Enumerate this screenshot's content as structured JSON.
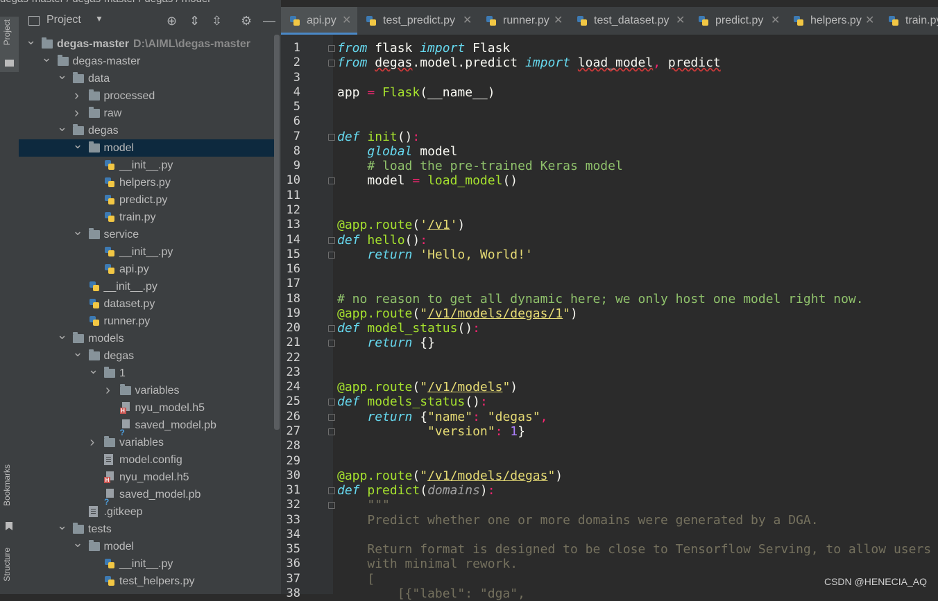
{
  "breadcrumb": {
    "items": [
      "degas-master",
      "degas-master",
      "degas",
      "model"
    ],
    "sep": " / "
  },
  "left_strip": {
    "project_label": "Project",
    "bookmarks_label": "Bookmarks",
    "structure_label": "Structure"
  },
  "project_panel": {
    "title": "Project"
  },
  "tree": [
    {
      "label": "degas-master",
      "sub": "D:\\AIML\\degas-master",
      "depth": 0,
      "arrow": "down",
      "icon": "folder",
      "bold": true
    },
    {
      "label": "degas-master",
      "depth": 1,
      "arrow": "down",
      "icon": "folder"
    },
    {
      "label": "data",
      "depth": 2,
      "arrow": "down",
      "icon": "folder"
    },
    {
      "label": "processed",
      "depth": 3,
      "arrow": "right",
      "icon": "folder"
    },
    {
      "label": "raw",
      "depth": 3,
      "arrow": "right",
      "icon": "folder"
    },
    {
      "label": "degas",
      "depth": 2,
      "arrow": "down",
      "icon": "folder"
    },
    {
      "label": "model",
      "depth": 3,
      "arrow": "down",
      "icon": "folder",
      "selected": true
    },
    {
      "label": "__init__.py",
      "depth": 4,
      "icon": "py"
    },
    {
      "label": "helpers.py",
      "depth": 4,
      "icon": "py"
    },
    {
      "label": "predict.py",
      "depth": 4,
      "icon": "py"
    },
    {
      "label": "train.py",
      "depth": 4,
      "icon": "py"
    },
    {
      "label": "service",
      "depth": 3,
      "arrow": "down",
      "icon": "folder"
    },
    {
      "label": "__init__.py",
      "depth": 4,
      "icon": "py"
    },
    {
      "label": "api.py",
      "depth": 4,
      "icon": "py"
    },
    {
      "label": "__init__.py",
      "depth": 3,
      "icon": "py"
    },
    {
      "label": "dataset.py",
      "depth": 3,
      "icon": "py"
    },
    {
      "label": "runner.py",
      "depth": 3,
      "icon": "py"
    },
    {
      "label": "models",
      "depth": 2,
      "arrow": "down",
      "icon": "folder"
    },
    {
      "label": "degas",
      "depth": 3,
      "arrow": "down",
      "icon": "folder"
    },
    {
      "label": "1",
      "depth": 4,
      "arrow": "down",
      "icon": "folder"
    },
    {
      "label": "variables",
      "depth": 5,
      "arrow": "right",
      "icon": "folder"
    },
    {
      "label": "nyu_model.h5",
      "depth": 5,
      "icon": "h5"
    },
    {
      "label": "saved_model.pb",
      "depth": 5,
      "icon": "pb"
    },
    {
      "label": "variables",
      "depth": 4,
      "arrow": "right",
      "icon": "folder"
    },
    {
      "label": "model.config",
      "depth": 4,
      "icon": "txt"
    },
    {
      "label": "nyu_model.h5",
      "depth": 4,
      "icon": "h5"
    },
    {
      "label": "saved_model.pb",
      "depth": 4,
      "icon": "pb"
    },
    {
      "label": ".gitkeep",
      "depth": 3,
      "icon": "txt"
    },
    {
      "label": "tests",
      "depth": 2,
      "arrow": "down",
      "icon": "folder"
    },
    {
      "label": "model",
      "depth": 3,
      "arrow": "down",
      "icon": "folder"
    },
    {
      "label": "__init__.py",
      "depth": 4,
      "icon": "py"
    },
    {
      "label": "test_helpers.py",
      "depth": 4,
      "icon": "py"
    }
  ],
  "tabs": [
    {
      "label": "api.py",
      "active": true
    },
    {
      "label": "test_predict.py"
    },
    {
      "label": "runner.py"
    },
    {
      "label": "test_dataset.py"
    },
    {
      "label": "predict.py"
    },
    {
      "label": "helpers.py"
    },
    {
      "label": "train.py"
    }
  ],
  "editor": {
    "highlight_line": 33,
    "lines": [
      [
        [
          "kw",
          "from"
        ],
        [
          "pl",
          " flask "
        ],
        [
          "kw",
          "import"
        ],
        [
          "pl",
          " Flask"
        ]
      ],
      [
        [
          "kw",
          "from"
        ],
        [
          "pl",
          " "
        ],
        [
          "wavy",
          "degas"
        ],
        [
          "pl",
          ".model.predict "
        ],
        [
          "kw",
          "import"
        ],
        [
          "pl",
          " "
        ],
        [
          "wavy",
          "load_model"
        ],
        [
          "op",
          ", "
        ],
        [
          "wavy",
          "predict"
        ]
      ],
      [],
      [
        [
          "pl",
          "app "
        ],
        [
          "op",
          "="
        ],
        [
          "pl",
          " "
        ],
        [
          "fn",
          "Flask"
        ],
        [
          "pl",
          "(__name__)"
        ]
      ],
      [],
      [],
      [
        [
          "kw",
          "def"
        ],
        [
          "pl",
          " "
        ],
        [
          "fn",
          "init"
        ],
        [
          "pl",
          "()"
        ],
        [
          "op",
          ":"
        ]
      ],
      [
        [
          "pl",
          "    "
        ],
        [
          "kw",
          "global"
        ],
        [
          "pl",
          " model"
        ]
      ],
      [
        [
          "pl",
          "    "
        ],
        [
          "cm",
          "# load the pre-trained Keras model"
        ]
      ],
      [
        [
          "pl",
          "    model "
        ],
        [
          "op",
          "="
        ],
        [
          "pl",
          " "
        ],
        [
          "fn",
          "load_model"
        ],
        [
          "pl",
          "()"
        ]
      ],
      [],
      [],
      [
        [
          "dec",
          "@app.route"
        ],
        [
          "pl",
          "("
        ],
        [
          "str",
          "'"
        ],
        [
          "stru",
          "/v1"
        ],
        [
          "str",
          "'"
        ],
        [
          "pl",
          ")"
        ]
      ],
      [
        [
          "kw",
          "def"
        ],
        [
          "pl",
          " "
        ],
        [
          "fn",
          "hello"
        ],
        [
          "pl",
          "()"
        ],
        [
          "op",
          ":"
        ]
      ],
      [
        [
          "pl",
          "    "
        ],
        [
          "kw",
          "return"
        ],
        [
          "pl",
          " "
        ],
        [
          "str",
          "'Hello, World!'"
        ]
      ],
      [],
      [],
      [
        [
          "cm",
          "# no reason to get all dynamic here; we only host one model right now."
        ]
      ],
      [
        [
          "dec",
          "@app.route"
        ],
        [
          "pl",
          "("
        ],
        [
          "str",
          "\""
        ],
        [
          "stru",
          "/v1/models/degas/1"
        ],
        [
          "str",
          "\""
        ],
        [
          "pl",
          ")"
        ]
      ],
      [
        [
          "kw",
          "def"
        ],
        [
          "pl",
          " "
        ],
        [
          "fn",
          "model_status"
        ],
        [
          "pl",
          "()"
        ],
        [
          "op",
          ":"
        ]
      ],
      [
        [
          "pl",
          "    "
        ],
        [
          "kw",
          "return"
        ],
        [
          "pl",
          " {}"
        ]
      ],
      [],
      [],
      [
        [
          "dec",
          "@app.route"
        ],
        [
          "pl",
          "("
        ],
        [
          "str",
          "\""
        ],
        [
          "stru",
          "/v1/models"
        ],
        [
          "str",
          "\""
        ],
        [
          "pl",
          ")"
        ]
      ],
      [
        [
          "kw",
          "def"
        ],
        [
          "pl",
          " "
        ],
        [
          "fn",
          "models_status"
        ],
        [
          "pl",
          "()"
        ],
        [
          "op",
          ":"
        ]
      ],
      [
        [
          "pl",
          "    "
        ],
        [
          "kw",
          "return"
        ],
        [
          "pl",
          " {"
        ],
        [
          "str",
          "\"name\""
        ],
        [
          "op",
          ":"
        ],
        [
          "pl",
          " "
        ],
        [
          "str",
          "\"degas\""
        ],
        [
          "op",
          ","
        ]
      ],
      [
        [
          "pl",
          "            "
        ],
        [
          "str",
          "\"version\""
        ],
        [
          "op",
          ":"
        ],
        [
          "pl",
          " "
        ],
        [
          "num",
          "1"
        ],
        [
          "pl",
          "}"
        ]
      ],
      [],
      [],
      [
        [
          "dec",
          "@app.route"
        ],
        [
          "pl",
          "("
        ],
        [
          "str",
          "\""
        ],
        [
          "stru",
          "/v1/models/degas"
        ],
        [
          "str",
          "\""
        ],
        [
          "pl",
          ")"
        ]
      ],
      [
        [
          "kw",
          "def"
        ],
        [
          "pl",
          " "
        ],
        [
          "fn",
          "predict"
        ],
        [
          "pl",
          "("
        ],
        [
          "par",
          "domains"
        ],
        [
          "pl",
          ")"
        ],
        [
          "op",
          ":"
        ]
      ],
      [
        [
          "pl",
          "    "
        ],
        [
          "doc",
          "\"\"\""
        ]
      ],
      [
        [
          "pl",
          "    "
        ],
        [
          "doc",
          "Predict whether one or more domains were generated by a DGA."
        ]
      ],
      [],
      [
        [
          "pl",
          "    "
        ],
        [
          "doc",
          "Return format is designed to be close to Tensorflow Serving, to allow users"
        ]
      ],
      [
        [
          "pl",
          "    "
        ],
        [
          "doc",
          "with minimal rework."
        ]
      ],
      [
        [
          "pl",
          "    "
        ],
        [
          "doc",
          "["
        ]
      ],
      [
        [
          "pl",
          "        "
        ],
        [
          "doc",
          "[{\"label\": \"dga\","
        ]
      ]
    ]
  },
  "watermark": "CSDN @HENECIA_AQ"
}
